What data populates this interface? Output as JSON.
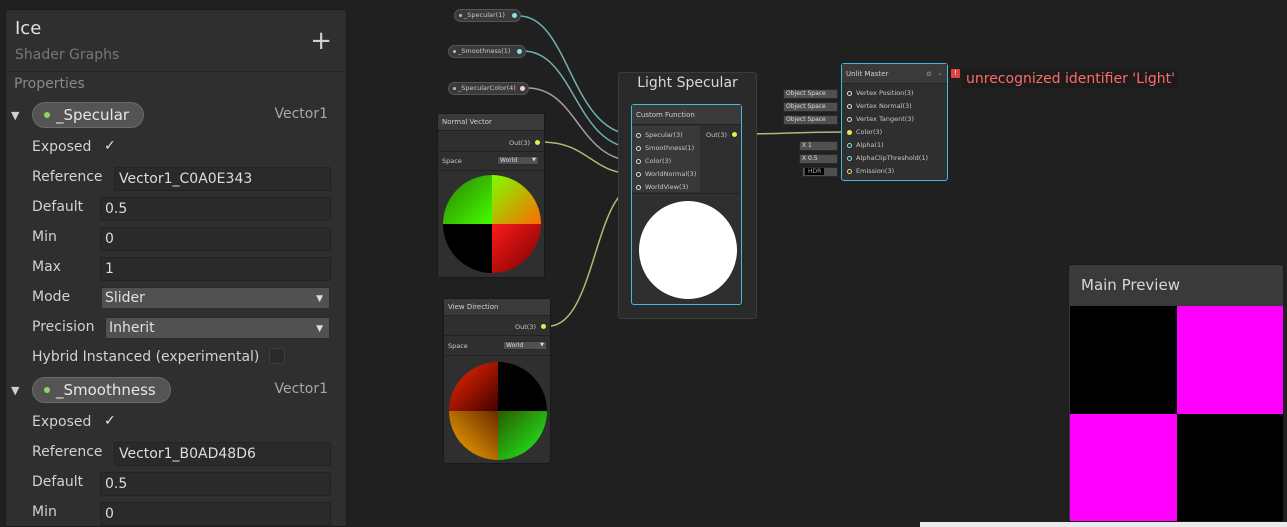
{
  "blackboard": {
    "title": "Ice",
    "subtitle": "Shader Graphs",
    "add_label": "+",
    "section_label": "Properties",
    "properties": [
      {
        "name": "_Specular",
        "type": "Vector1",
        "exposed_label": "Exposed",
        "reference_label": "Reference",
        "reference": "Vector1_C0A0E343",
        "default_label": "Default",
        "default": "0.5",
        "min_label": "Min",
        "min": "0",
        "max_label": "Max",
        "max": "1",
        "mode_label": "Mode",
        "mode": "Slider",
        "precision_label": "Precision",
        "precision": "Inherit",
        "hybrid_label": "Hybrid Instanced (experimental)"
      },
      {
        "name": "_Smoothness",
        "type": "Vector1",
        "exposed_label": "Exposed",
        "reference_label": "Reference",
        "reference": "Vector1_B0AD48D6",
        "default_label": "Default",
        "default": "0.5",
        "min_label": "Min",
        "min": "0"
      }
    ]
  },
  "graph": {
    "property_nodes": [
      "_Specular(1)",
      "_Smoothness(1)",
      "_SpecularColor(4)"
    ],
    "normal_vector": {
      "title": "Normal Vector",
      "out": "Out(3)",
      "space_label": "Space",
      "space": "World"
    },
    "view_direction": {
      "title": "View Direction",
      "out": "Out(3)",
      "space_label": "Space",
      "space": "World"
    },
    "group_title": "Light Specular",
    "custom_function": {
      "title": "Custom Function",
      "inputs": [
        "Specular(3)",
        "Smoothness(1)",
        "Color(3)",
        "WorldNormal(3)",
        "WorldView(3)"
      ],
      "out": "Out(3)"
    },
    "unlit_master": {
      "title": "Unlit Master",
      "ports": [
        "Vertex Position(3)",
        "Vertex Normal(3)",
        "Vertex Tangent(3)",
        "Color(3)",
        "Alpha(1)",
        "AlphaClipThreshold(1)",
        "Emission(3)"
      ],
      "space_inputs": [
        "Object Space",
        "Object Space",
        "Object Space"
      ],
      "alpha_label": "X",
      "alpha_value": "1",
      "clip_label": "X",
      "clip_value": "0.5",
      "hdr_label": "HDR"
    },
    "error_badge": "!",
    "error_message": "unrecognized identifier 'Light'"
  },
  "main_preview": {
    "title": "Main Preview"
  },
  "colors": {
    "selection": "#45b9e0",
    "error": "#ff6a6a",
    "preview_magenta": "#ff00ff",
    "port_vector3": "#e8e85a",
    "port_vector1": "#84e4e7",
    "port_vector4": "#fbcbf4"
  }
}
